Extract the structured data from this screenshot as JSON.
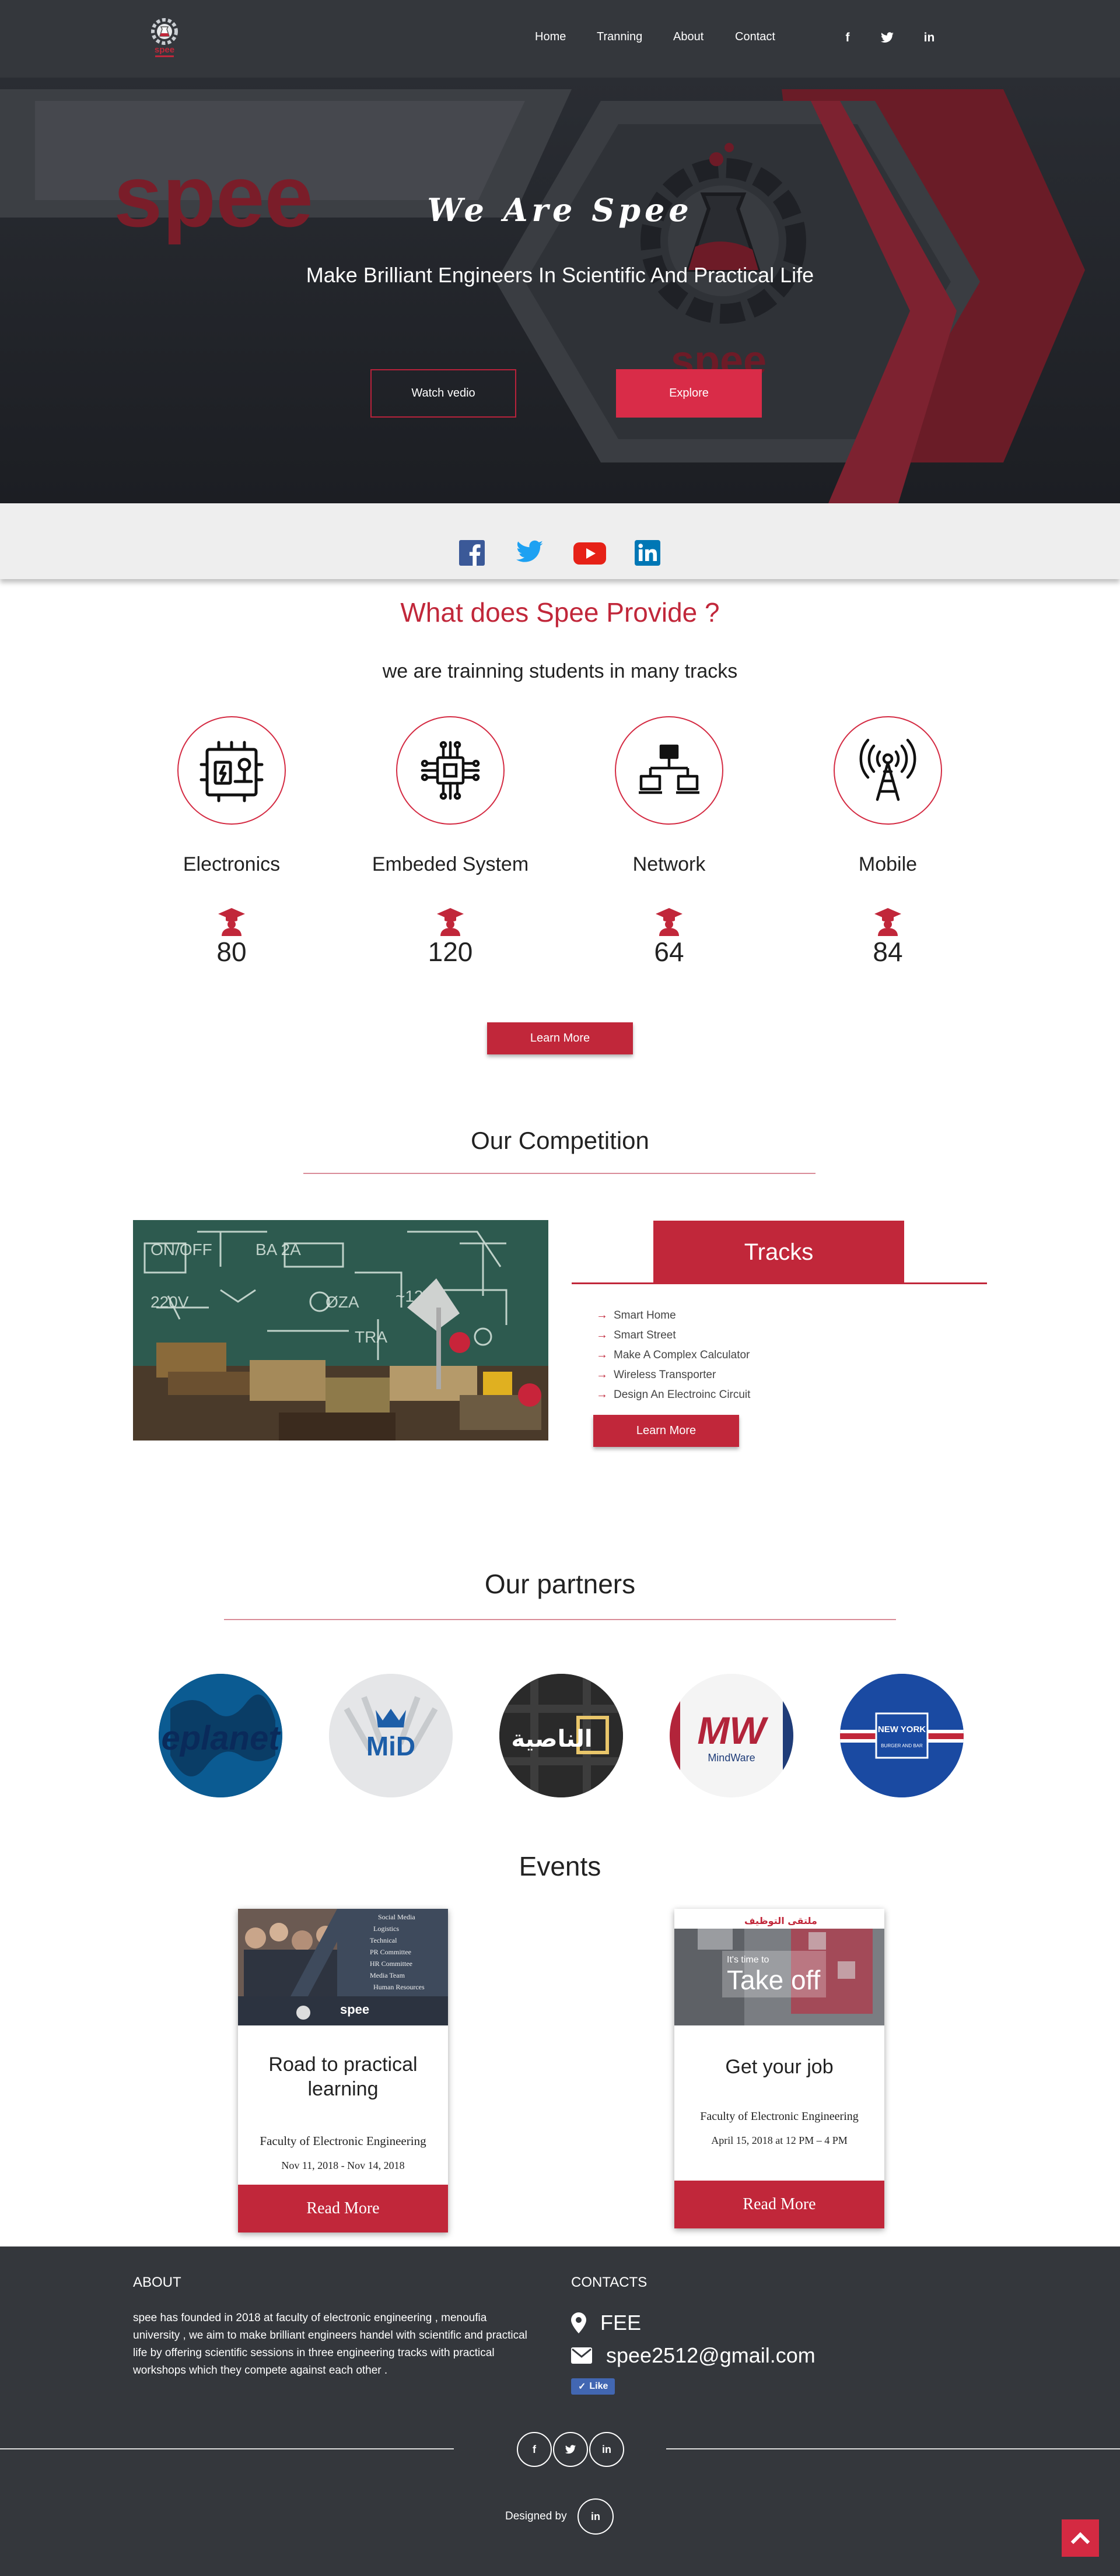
{
  "nav": {
    "links": [
      "Home",
      "Tranning",
      "About",
      "Contact"
    ],
    "social_icons": [
      "facebook-icon",
      "twitter-icon",
      "linkedin-icon"
    ],
    "logo_text": "spee"
  },
  "hero": {
    "title": "We Are Spee",
    "subtitle": "Make Brilliant Engineers In Scientific And Practical Life",
    "watch_label": "Watch vedio",
    "explore_label": "Explore",
    "background_logo_text": "spee"
  },
  "social_bar": [
    "facebook-icon",
    "twitter-icon",
    "youtube-icon",
    "linkedin-icon"
  ],
  "provide": {
    "title": "What does Spee Provide ?",
    "subtitle": "we are trainning students in many tracks",
    "tracks": [
      {
        "name": "Electronics",
        "count": "80",
        "icon": "circuit-board-icon"
      },
      {
        "name": "Embeded System",
        "count": "120",
        "icon": "microchip-icon"
      },
      {
        "name": "Network",
        "count": "64",
        "icon": "network-icon"
      },
      {
        "name": "Mobile",
        "count": "84",
        "icon": "antenna-icon"
      }
    ],
    "learn_more_label": "Learn More"
  },
  "competition": {
    "title": "Our Competition",
    "tracks_label": "Tracks",
    "items": [
      "Smart Home",
      "Smart Street",
      "Make A Complex Calculator",
      "Wireless Transporter",
      "Design An Electroinc Circuit"
    ],
    "learn_more_label": "Learn More"
  },
  "partners": {
    "title": "Our partners",
    "logos": [
      {
        "name": "eplanet",
        "text": "eplanet"
      },
      {
        "name": "mid",
        "text": "MiD"
      },
      {
        "name": "alnasia",
        "text": "الناصية"
      },
      {
        "name": "mindware",
        "text": "MW",
        "sub": "MindWare"
      },
      {
        "name": "new-york",
        "text": "NEW YORK",
        "sub": "BURGER AND BAR"
      }
    ]
  },
  "events": {
    "title": "Events",
    "cards": [
      {
        "title": "Road to practical learning",
        "place": "Faculty of Electronic Engineering",
        "date": "Nov 11, 2018 - Nov 14, 2018",
        "button": "Read More",
        "image_lines": [
          "Social Media",
          "Logistics",
          "Technical",
          "PR Committee",
          "HR Committee",
          "Media Team",
          "Human Resources"
        ]
      },
      {
        "title": "Get your job",
        "place": "Faculty of Electronic Engineering",
        "date": "April 15, 2018 at 12 PM – 4 PM",
        "button": "Read More",
        "image_text": "Take off",
        "image_pre": "It's time to"
      }
    ]
  },
  "footer": {
    "about_title": "ABOUT",
    "about_text": "spee has founded in 2018 at faculty of electronic engineering , menoufia university , we aim to make brilliant engineers handel with scientific and practical life by offering scientific sessions in three engineering tracks with practical workshops which they compete against each other .",
    "contacts_title": "CONTACTS",
    "location": "FEE",
    "email": "spee2512@gmail.com",
    "like_label": "Like",
    "designed_by": "Designed by",
    "social_icons": [
      "facebook-icon",
      "twitter-icon",
      "linkedin-icon"
    ]
  },
  "colors": {
    "accent": "#c1273a",
    "dark": "#34373c",
    "light_bar": "#eeeeee"
  }
}
